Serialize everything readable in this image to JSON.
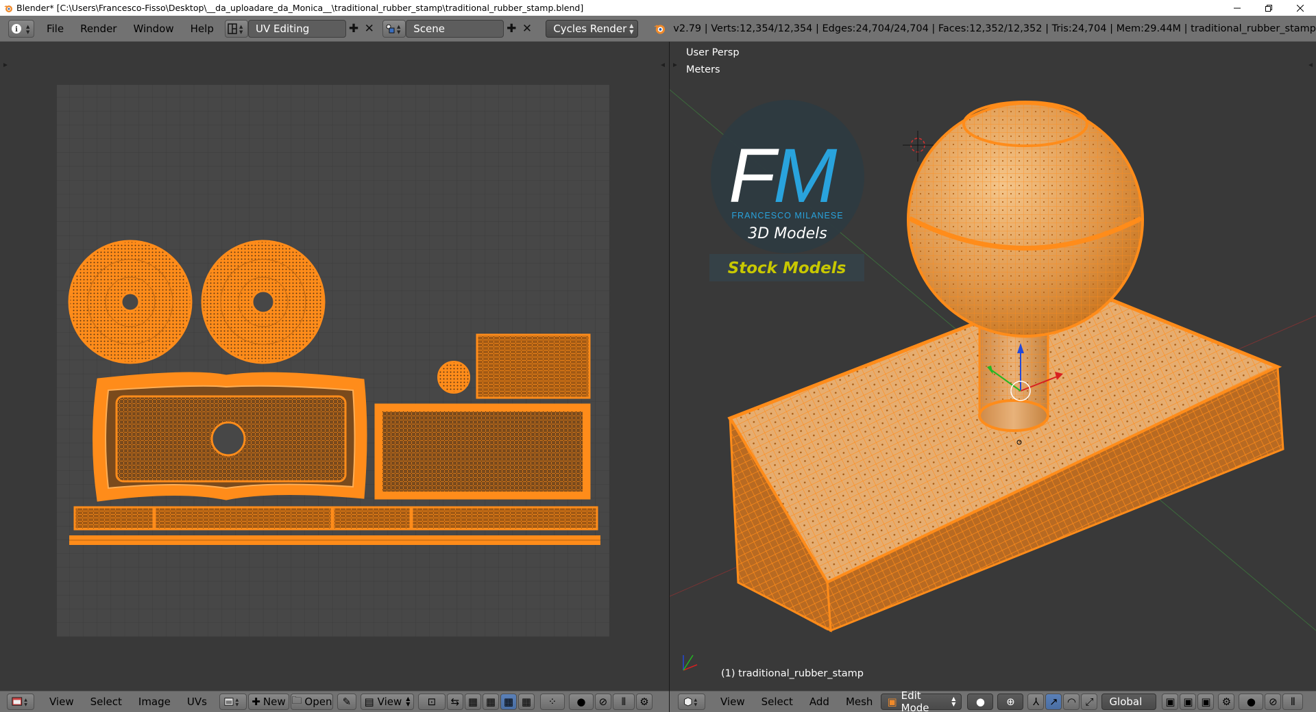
{
  "window": {
    "title": "Blender* [C:\\Users\\Francesco-Fisso\\Desktop\\__da_uploadare_da_Monica__\\traditional_rubber_stamp\\traditional_rubber_stamp.blend]"
  },
  "info_header": {
    "menus": [
      "File",
      "Render",
      "Window",
      "Help"
    ],
    "screen_layout": "UV Editing",
    "scene": "Scene",
    "render_engine": "Cycles Render",
    "stats": "v2.79 | Verts:12,354/12,354 | Edges:24,704/24,704 | Faces:12,352/12,352 | Tris:24,704 | Mem:29.44M | traditional_rubber_stamp"
  },
  "uv_editor": {
    "menus": [
      "View",
      "Select",
      "Image",
      "UVs"
    ],
    "new_label": "New",
    "open_label": "Open",
    "view_label": "View"
  },
  "viewport": {
    "view_name": "User Persp",
    "units": "Meters",
    "object_label": "(1) traditional_rubber_stamp",
    "menus": [
      "View",
      "Select",
      "Add",
      "Mesh"
    ],
    "mode": "Edit Mode",
    "orientation": "Global"
  },
  "logo": {
    "initials_f": "F",
    "initials_m": "M",
    "name": "FRANCESCO MILANESE",
    "subtitle": "3D Models",
    "banner": "Stock Models"
  },
  "colors": {
    "header_bg": "#727272",
    "editor_bg": "#393939",
    "uv_grid_bg": "#474747",
    "mesh_orange": "#ff8c1a",
    "logo_blue": "#29a3dd",
    "logo_yellow": "#c8c800"
  }
}
